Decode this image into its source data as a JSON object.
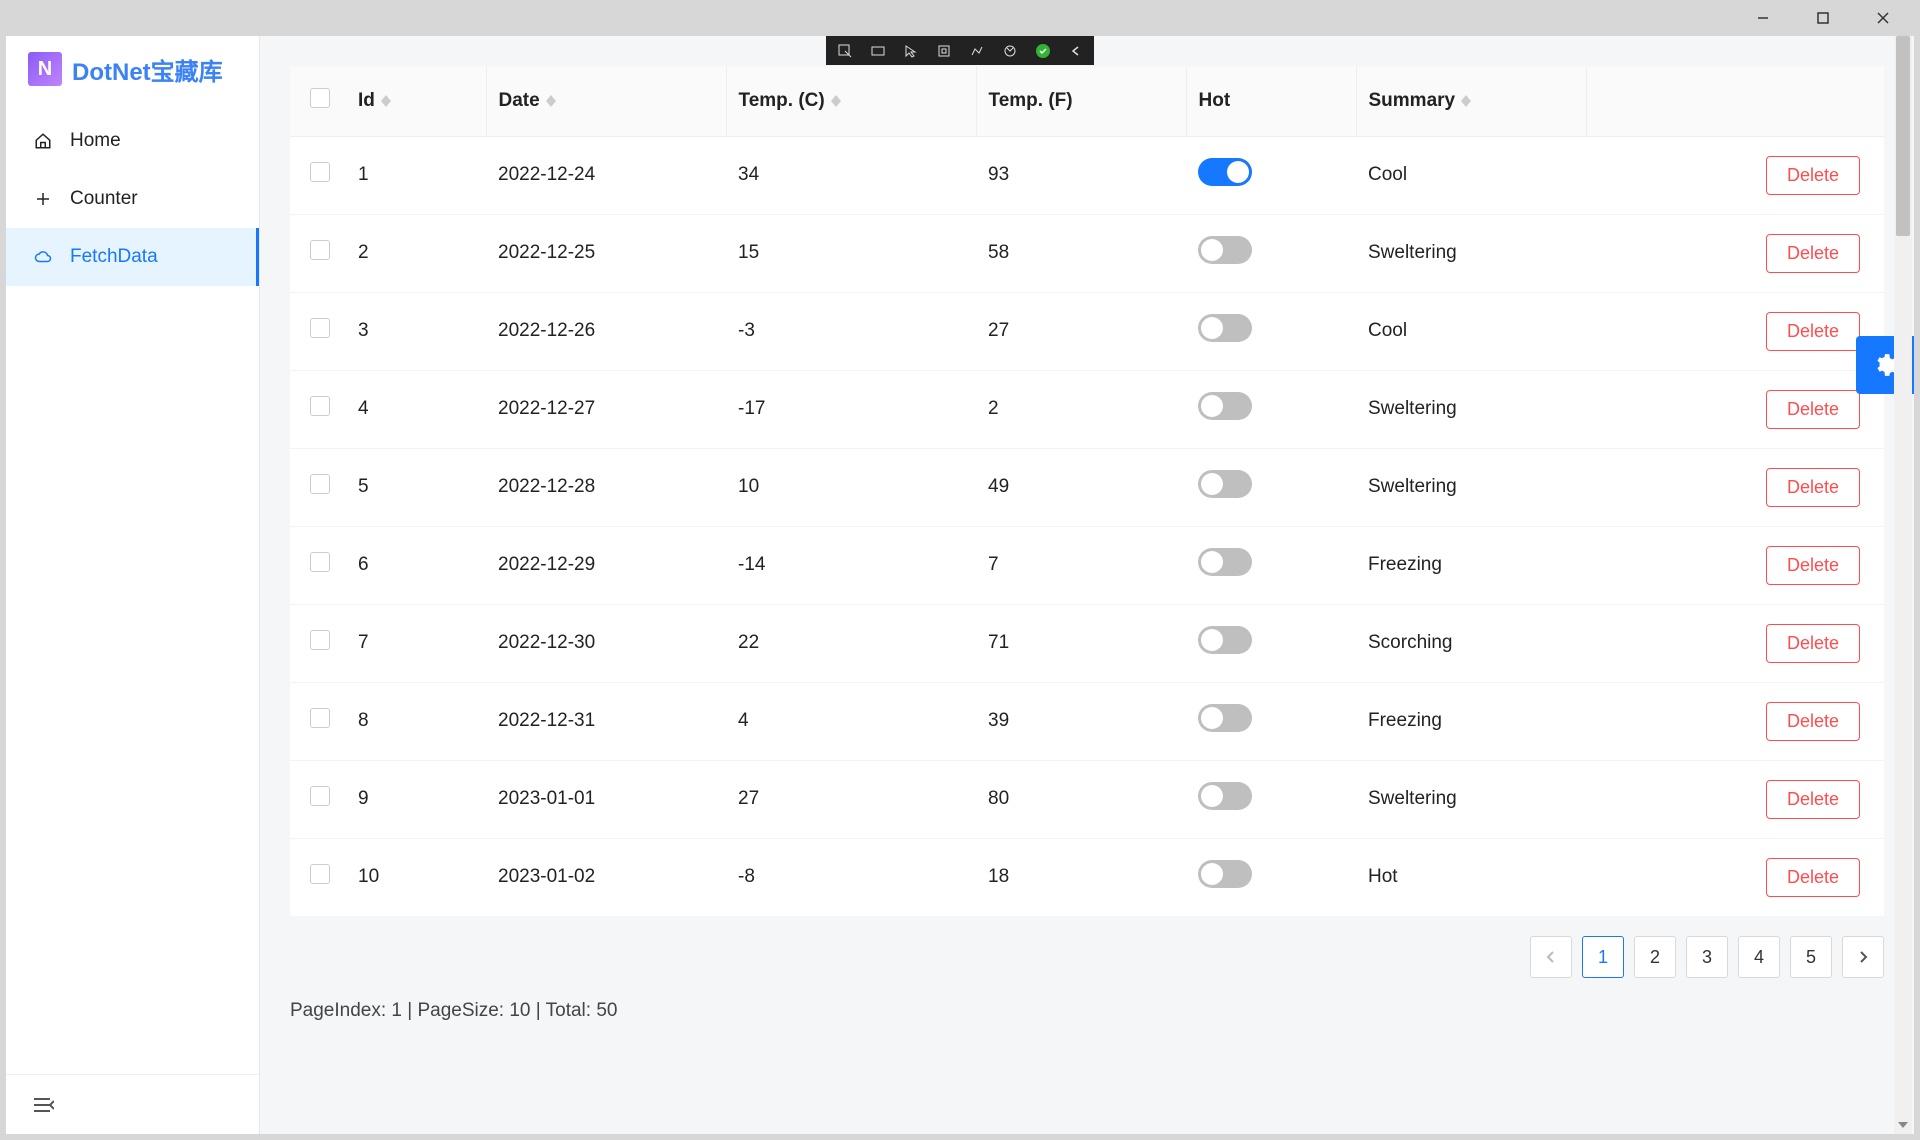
{
  "brand": "DotNet宝藏库",
  "sidebar": {
    "items": [
      {
        "label": "Home",
        "icon": "home-icon",
        "active": false
      },
      {
        "label": "Counter",
        "icon": "plus-icon",
        "active": false
      },
      {
        "label": "FetchData",
        "icon": "cloud-icon",
        "active": true
      }
    ]
  },
  "table": {
    "columns": {
      "id": "Id",
      "date": "Date",
      "tc": "Temp. (C)",
      "tf": "Temp. (F)",
      "hot": "Hot",
      "summary": "Summary"
    },
    "delete_label": "Delete",
    "rows": [
      {
        "id": "1",
        "date": "2022-12-24",
        "tc": "34",
        "tf": "93",
        "hot": true,
        "summary": "Cool"
      },
      {
        "id": "2",
        "date": "2022-12-25",
        "tc": "15",
        "tf": "58",
        "hot": false,
        "summary": "Sweltering"
      },
      {
        "id": "3",
        "date": "2022-12-26",
        "tc": "-3",
        "tf": "27",
        "hot": false,
        "summary": "Cool"
      },
      {
        "id": "4",
        "date": "2022-12-27",
        "tc": "-17",
        "tf": "2",
        "hot": false,
        "summary": "Sweltering"
      },
      {
        "id": "5",
        "date": "2022-12-28",
        "tc": "10",
        "tf": "49",
        "hot": false,
        "summary": "Sweltering"
      },
      {
        "id": "6",
        "date": "2022-12-29",
        "tc": "-14",
        "tf": "7",
        "hot": false,
        "summary": "Freezing"
      },
      {
        "id": "7",
        "date": "2022-12-30",
        "tc": "22",
        "tf": "71",
        "hot": false,
        "summary": "Scorching"
      },
      {
        "id": "8",
        "date": "2022-12-31",
        "tc": "4",
        "tf": "39",
        "hot": false,
        "summary": "Freezing"
      },
      {
        "id": "9",
        "date": "2023-01-01",
        "tc": "27",
        "tf": "80",
        "hot": false,
        "summary": "Sweltering"
      },
      {
        "id": "10",
        "date": "2023-01-02",
        "tc": "-8",
        "tf": "18",
        "hot": false,
        "summary": "Hot"
      }
    ]
  },
  "pagination": {
    "pages": [
      "1",
      "2",
      "3",
      "4",
      "5"
    ],
    "active": "1"
  },
  "status": "PageIndex: 1 | PageSize: 10 | Total: 50"
}
